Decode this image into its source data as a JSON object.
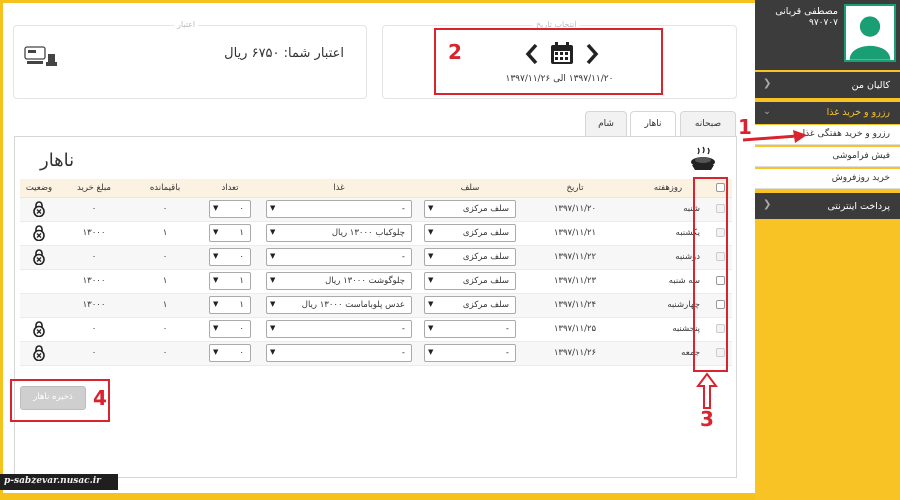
{
  "profile": {
    "name": "مصطفی قربانی",
    "id": "۹۷۰۷۰۷"
  },
  "sidebar": {
    "my_wallet": "کالیان من",
    "reserve_group": "رزرو و خرید غذا",
    "weekly_reserve": "رزرو و خرید هفتگی غذا",
    "forgotten_slip": "فیش فراموشی",
    "daily_buy": "خرید روزفروش",
    "online_payment": "پرداخت اینترنتی"
  },
  "credit": {
    "caption": "اعتبار",
    "text": "اعتبار شما: ۶۷۵۰ ریال"
  },
  "date_panel": {
    "caption": "انتخاب تاریخ",
    "range": "۱۳۹۷/۱۱/۲۰ الی ۱۳۹۷/۱۱/۲۶"
  },
  "tabs": {
    "breakfast": "صبحانه",
    "lunch": "ناهار",
    "dinner": "شام"
  },
  "heading": "ناهار",
  "table": {
    "headers": {
      "day": "روزهفته",
      "date": "تاریخ",
      "self": "سلف",
      "food": "غذا",
      "count": "تعداد",
      "remaining": "باقیمانده",
      "price": "مبلغ خرید",
      "status": "وضعیت"
    },
    "rows": [
      {
        "day": "شنبه",
        "date": "۱۳۹۷/۱۱/۲۰",
        "self": "سلف مرکزی",
        "food": "-",
        "count": "۰",
        "remaining": "۰",
        "price": "۰"
      },
      {
        "day": "یکشنبه",
        "date": "۱۳۹۷/۱۱/۲۱",
        "self": "سلف مرکزی",
        "food": "چلوکباب ۱۳۰۰۰ ریال",
        "count": "۱",
        "remaining": "۱",
        "price": "۱۳۰۰۰"
      },
      {
        "day": "دوشنبه",
        "date": "۱۳۹۷/۱۱/۲۲",
        "self": "سلف مرکزی",
        "food": "-",
        "count": "۰",
        "remaining": "۰",
        "price": "۰"
      },
      {
        "day": "سه شنبه",
        "date": "۱۳۹۷/۱۱/۲۳",
        "self": "سلف مرکزی",
        "food": "چلوگوشت ۱۳۰۰۰ ریال",
        "count": "۱",
        "remaining": "۱",
        "price": "۱۳۰۰۰"
      },
      {
        "day": "چهارشنبه",
        "date": "۱۳۹۷/۱۱/۲۴",
        "self": "سلف مرکزی",
        "food": "عدس پلوباماست ۱۳۰۰۰ ریال",
        "count": "۱",
        "remaining": "۱",
        "price": "۱۳۰۰۰"
      },
      {
        "day": "پنجشنبه",
        "date": "۱۳۹۷/۱۱/۲۵",
        "self": "-",
        "food": "-",
        "count": "۰",
        "remaining": "۰",
        "price": "۰"
      },
      {
        "day": "جمعه",
        "date": "۱۳۹۷/۱۱/۲۶",
        "self": "-",
        "food": "-",
        "count": "۰",
        "remaining": "۰",
        "price": "۰"
      }
    ]
  },
  "save_button": "ذخیره ناهار",
  "annotations": {
    "a1": "1",
    "a2": "2",
    "a3": "3",
    "a4": "4"
  },
  "watermark": "p-sabzevar.nusac.ir",
  "colors": {
    "accent": "#f7c325",
    "annotation": "#d9232e",
    "sidebar_dark": "#3b3b3b"
  }
}
